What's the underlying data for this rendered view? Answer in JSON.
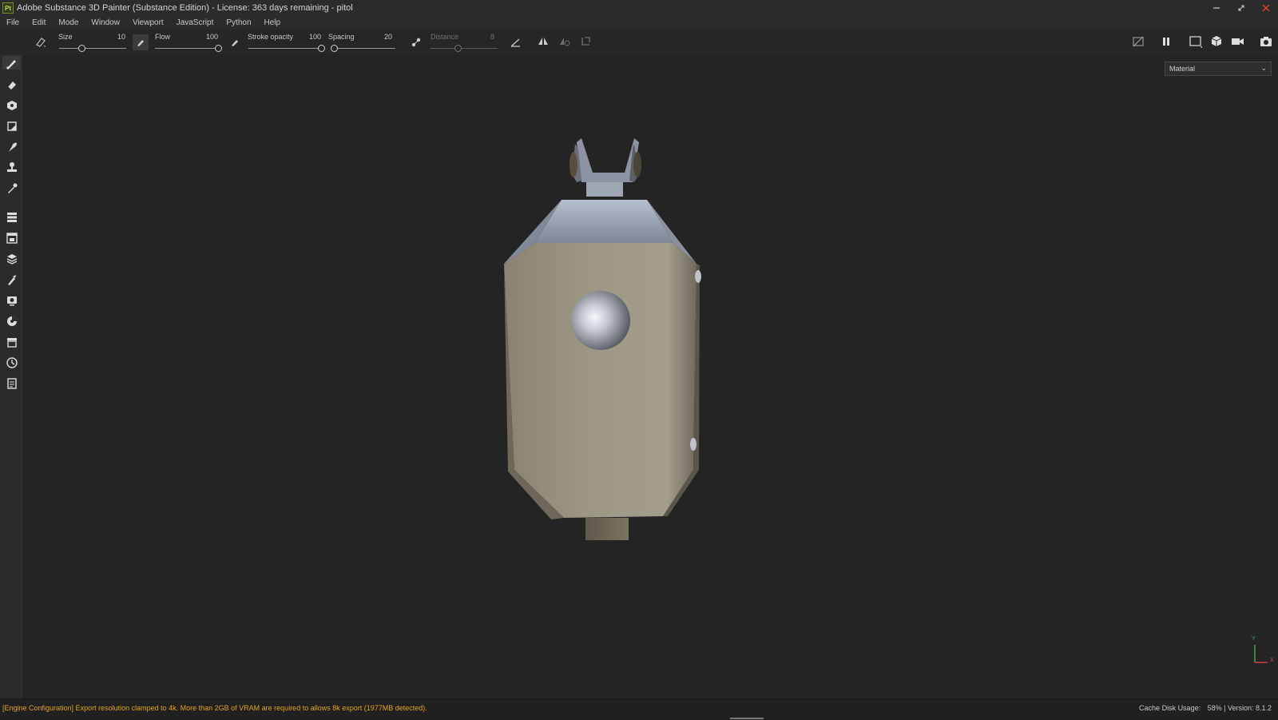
{
  "window": {
    "app_icon": "Pt",
    "title": "Adobe Substance 3D Painter (Substance Edition) - License: 363 days remaining - pitol",
    "controls": [
      "minimize-icon",
      "restore-icon",
      "close-icon"
    ]
  },
  "menu": {
    "items": [
      "File",
      "Edit",
      "Mode",
      "Window",
      "Viewport",
      "JavaScript",
      "Python",
      "Help"
    ]
  },
  "toolbar": {
    "size": {
      "label": "Size",
      "value": "10",
      "fraction": 0.35
    },
    "flow": {
      "label": "Flow",
      "value": "100",
      "fraction": 1.0
    },
    "stroke_opacity": {
      "label": "Stroke opacity",
      "value": "100",
      "fraction": 1.0
    },
    "spacing": {
      "label": "Spacing",
      "value": "20",
      "fraction": 0.05
    },
    "distance": {
      "label": "Distance",
      "value": "8",
      "fraction": 0.42
    },
    "right_icons": [
      "hide-icon",
      "pause-icon",
      "display-mode-icon",
      "cube-view-icon",
      "camera-icon",
      "screenshot-icon"
    ]
  },
  "sidebar": {
    "tools": [
      "paint-brush-icon",
      "eraser-icon",
      "projection-icon",
      "polygon-fill-icon",
      "smudge-icon",
      "clone-stamp-icon",
      "color-picker-icon"
    ],
    "panels": [
      "layers-stack-icon",
      "texture-set-icon",
      "layers-icon",
      "properties-icon",
      "display-settings-icon",
      "shader-settings-icon",
      "assets-icon",
      "history-icon",
      "log-icon"
    ]
  },
  "viewport": {
    "channel_dropdown": "Material",
    "axis_labels": {
      "y": "Y",
      "x": "X"
    }
  },
  "status": {
    "message": "[Engine Configuration] Export resolution clamped to 4k. More than 2GB of VRAM are required to allows 8k export (1977MB detected).",
    "cache_label": "Cache Disk Usage:",
    "cache_value": "58% | Version: 8.1.2"
  },
  "colors": {
    "warning": "#e6a21e",
    "close_button": "#e0402f",
    "axis_y": "#4caf50",
    "axis_x": "#e04040"
  }
}
